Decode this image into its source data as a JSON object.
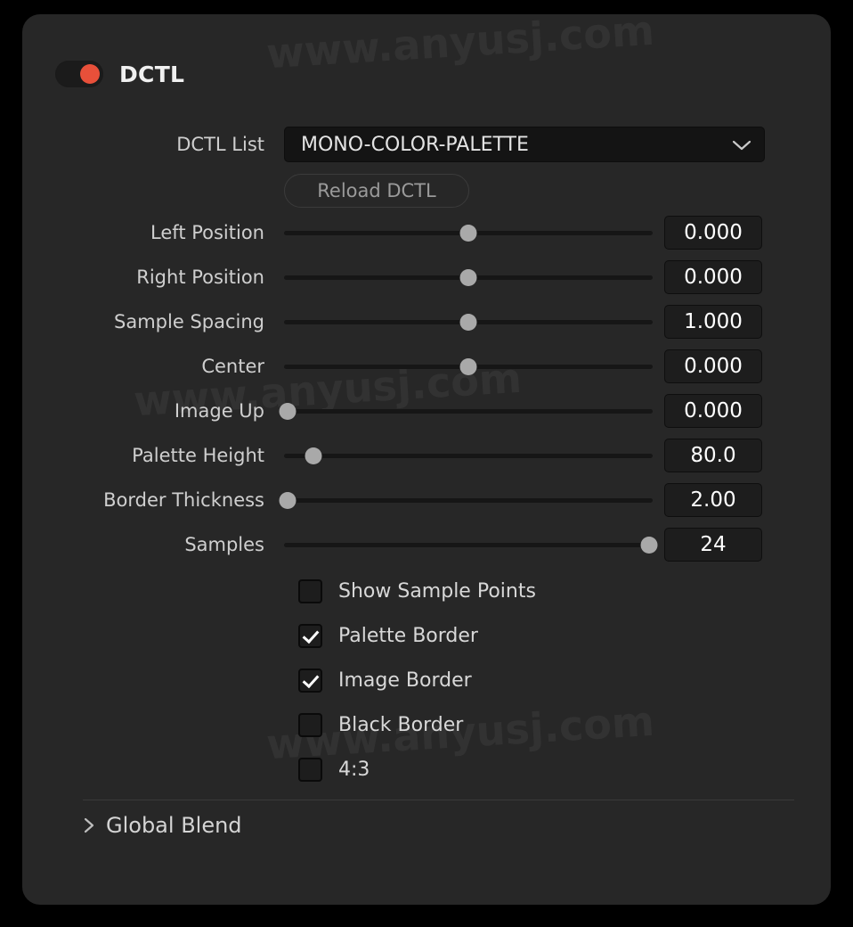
{
  "watermark": {
    "text": "www.anyusj.com",
    "occurrences": 3
  },
  "panel": {
    "background_color": "#272727",
    "page_background_color": "#000000"
  },
  "header": {
    "title": "DCTL",
    "toggle": {
      "name": "dctl-enable-toggle",
      "state": "on",
      "knob_color": "#e8503a",
      "track_color": "#1b1b1b"
    }
  },
  "dctl_list": {
    "label": "DCTL List",
    "value": "MONO-COLOR-PALETTE",
    "chevron": "chevron-down-icon"
  },
  "reload": {
    "label": "Reload DCTL"
  },
  "sliders": [
    {
      "label": "Left Position",
      "value": "0.000",
      "percent": 50
    },
    {
      "label": "Right Position",
      "value": "0.000",
      "percent": 50
    },
    {
      "label": "Sample Spacing",
      "value": "1.000",
      "percent": 50
    },
    {
      "label": "Center",
      "value": "0.000",
      "percent": 50
    },
    {
      "label": "Image Up",
      "value": "0.000",
      "percent": 1
    },
    {
      "label": "Palette Height",
      "value": "80.0",
      "percent": 8
    },
    {
      "label": "Border Thickness",
      "value": "2.00",
      "percent": 1
    },
    {
      "label": "Samples",
      "value": "24",
      "percent": 99
    }
  ],
  "checkboxes": [
    {
      "label": "Show Sample Points",
      "checked": false
    },
    {
      "label": "Palette Border",
      "checked": true
    },
    {
      "label": "Image Border",
      "checked": false
    },
    {
      "label": "Black Border",
      "checked": false
    },
    {
      "label": "4:3",
      "checked": false
    }
  ],
  "checkbox_states_visual": {
    "note": "Palette Border and Image Border are checked"
  },
  "global_blend": {
    "label": "Global Blend",
    "caret": "chevron-right-icon",
    "expanded": false
  },
  "colors": {
    "accent": "#e8503a",
    "panel": "#272727",
    "track": "#161616",
    "thumb": "#a9a9a9",
    "text": "#d8d8d8",
    "value_box": "#1d1d1d"
  }
}
